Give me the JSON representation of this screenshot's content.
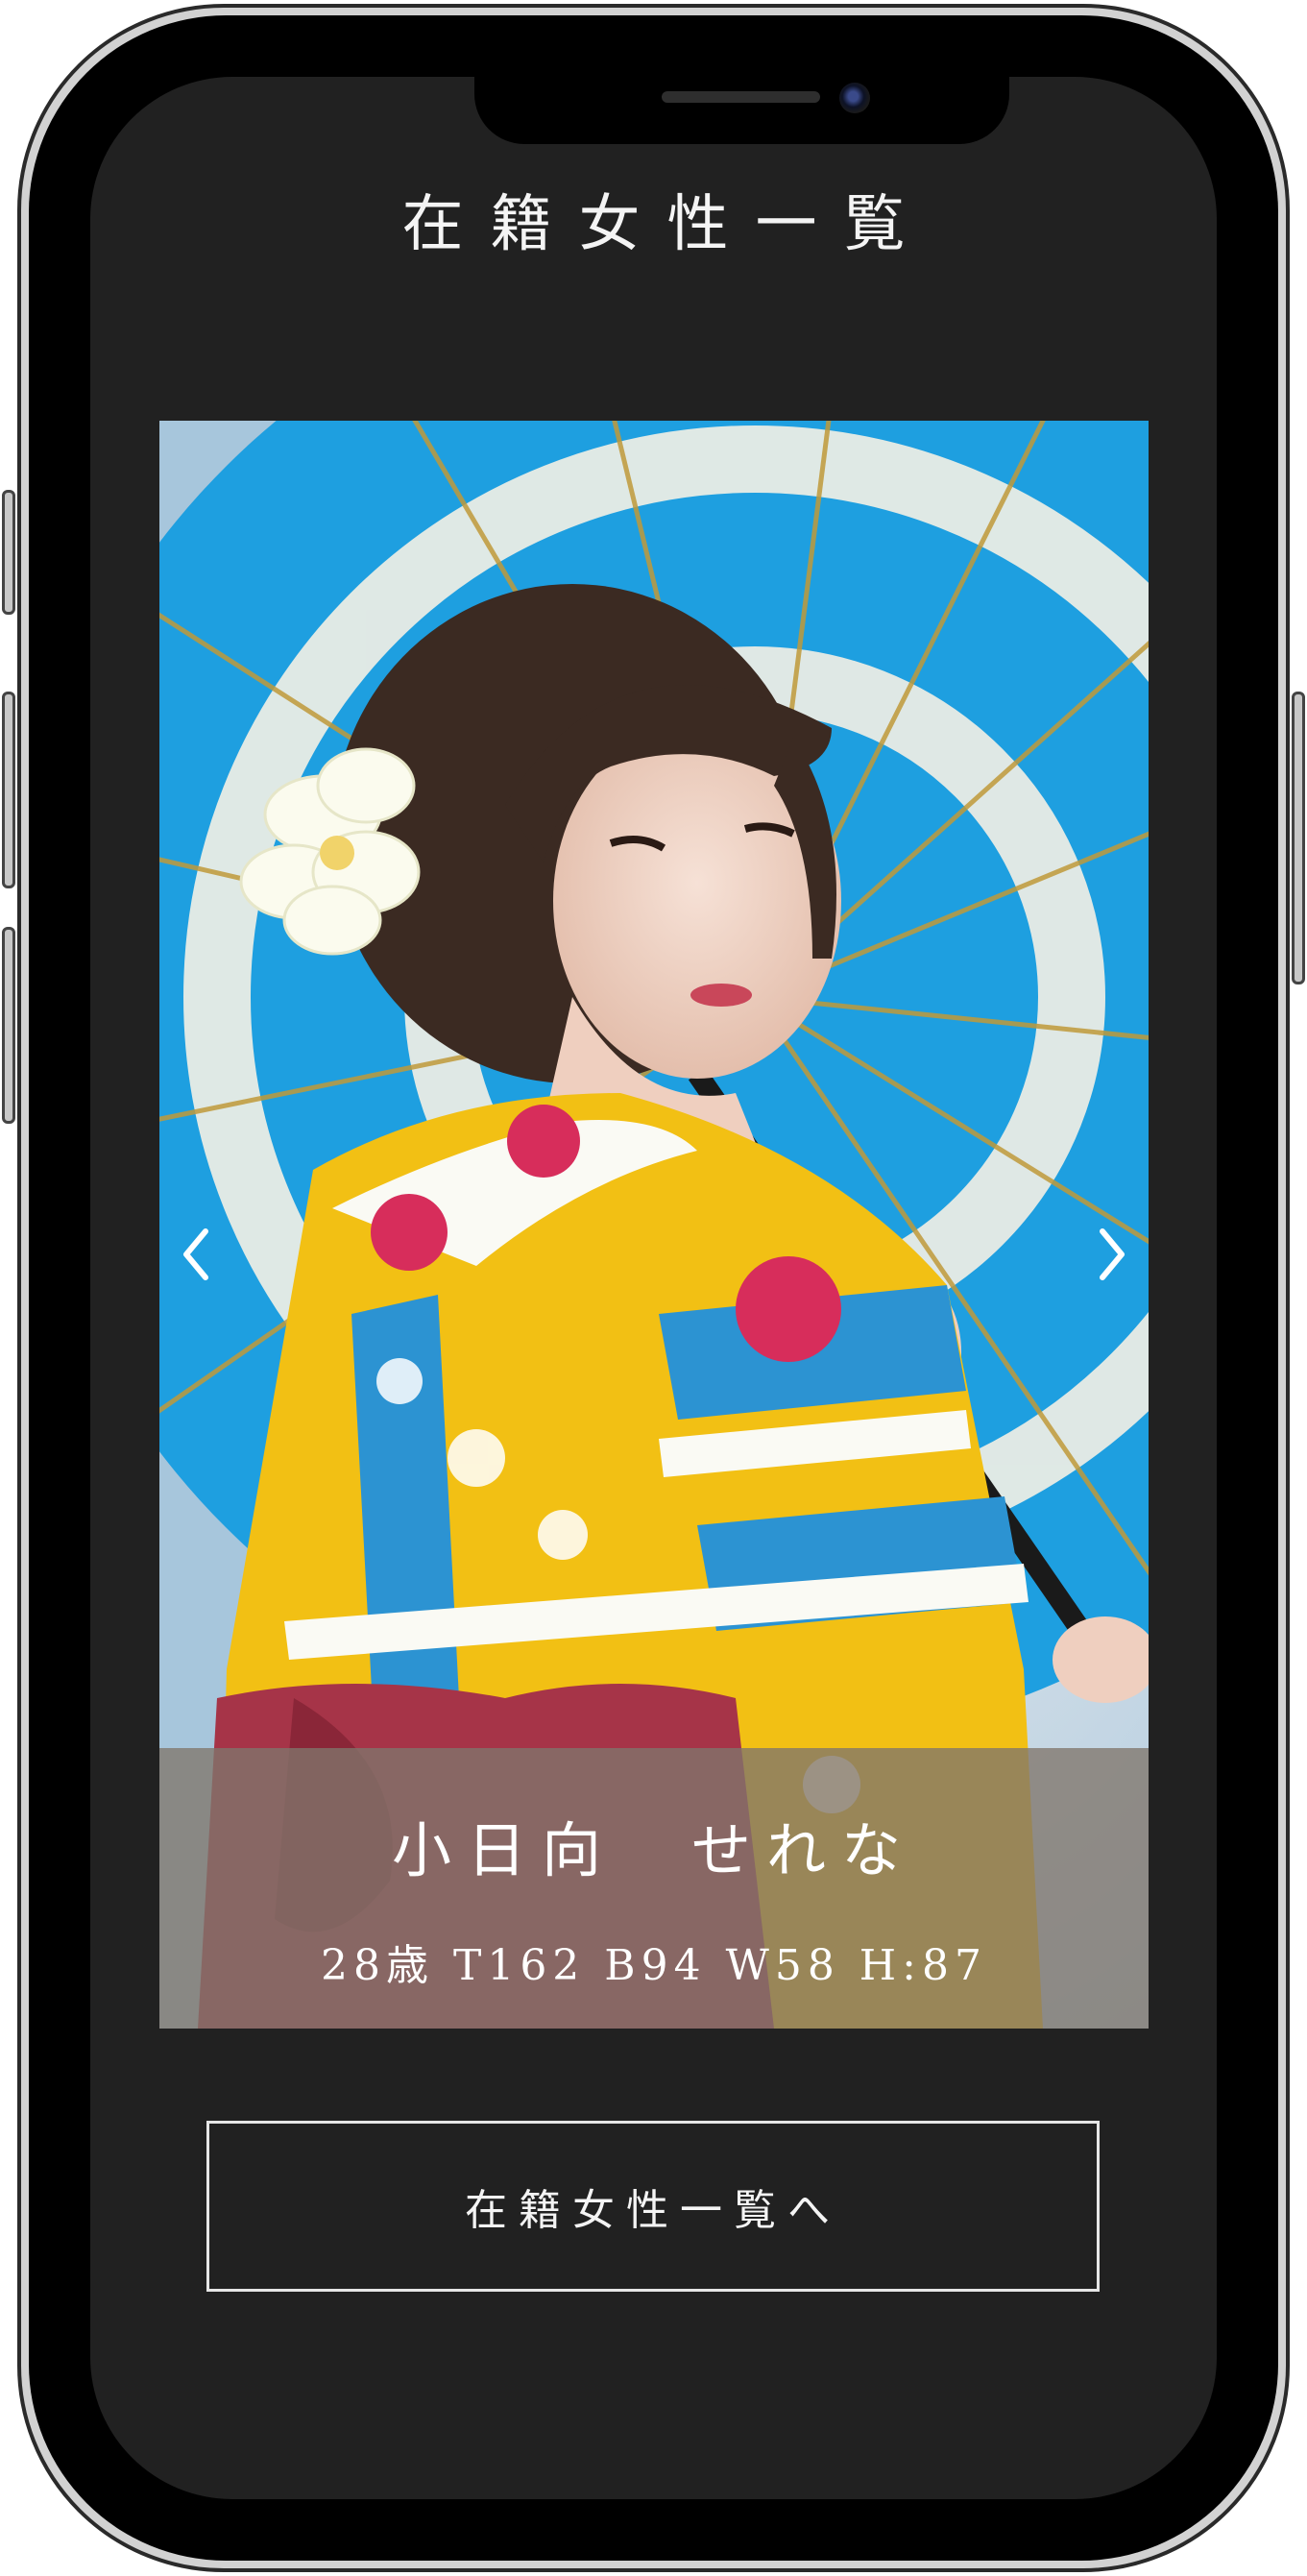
{
  "page": {
    "title": "在籍女性一覧"
  },
  "slider": {
    "current_item": {
      "name": "小日向　せれな",
      "stats": "28歳 T162 B94 W58 H:87"
    },
    "prev_icon": "chevron-left-icon",
    "next_icon": "chevron-right-icon"
  },
  "cta": {
    "label": "在籍女性一覧へ"
  },
  "colors": {
    "screen_background": "#212121",
    "caption_overlay": "#80766c",
    "text": "#ffffff",
    "button_border": "#e6e6e6"
  }
}
